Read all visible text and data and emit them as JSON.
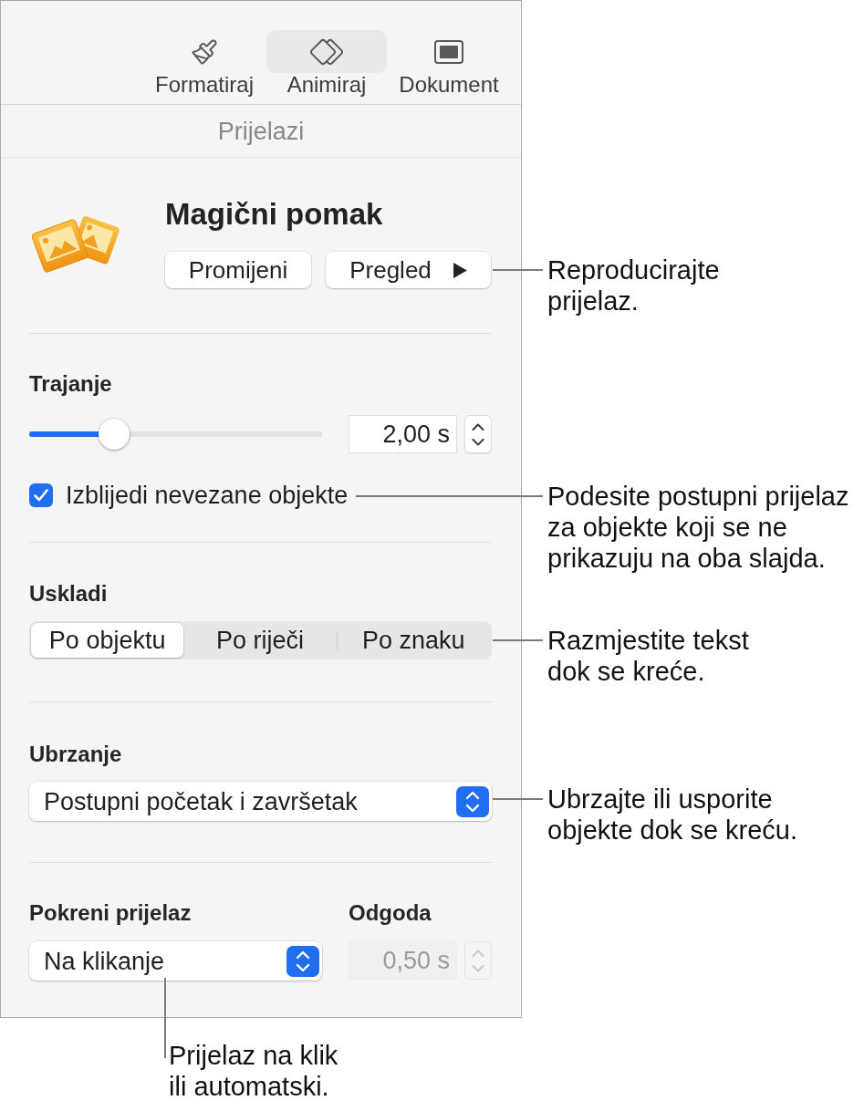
{
  "toolbar": {
    "tabs": [
      {
        "label": "Formatiraj",
        "kind": "format",
        "selected": false
      },
      {
        "label": "Animiraj",
        "kind": "animate",
        "selected": true
      },
      {
        "label": "Dokument",
        "kind": "document",
        "selected": false
      }
    ]
  },
  "panel_title": "Prijelazi",
  "effect": {
    "title": "Magični pomak",
    "buttons": [
      {
        "label": "Promijeni",
        "kind": "plain"
      },
      {
        "label": "Pregled",
        "kind": "play"
      }
    ]
  },
  "duration": {
    "label": "Trajanje",
    "level": 0.29,
    "value": "2,00 s"
  },
  "fade_checkbox": {
    "label": "Izblijedi nevezane objekte",
    "checked": true
  },
  "align": {
    "label": "Uskladi",
    "segments": [
      {
        "label": "Po objektu",
        "selected": true
      },
      {
        "label": "Po riječi",
        "selected": false
      },
      {
        "label": "Po znaku",
        "selected": false
      }
    ]
  },
  "acceleration": {
    "label": "Ubrzanje",
    "value": "Postupni početak i završetak"
  },
  "start": {
    "label": "Pokreni prijelaz",
    "value": "Na klikanje"
  },
  "delay": {
    "label": "Odgoda",
    "value": "0,50 s",
    "disabled": true
  },
  "callouts": [
    {
      "kind": "side",
      "text": "Reproducirajte\nprijelaz."
    },
    {
      "kind": "side",
      "text": "Podesite postupni prijelaz\nza objekte koji se ne\nprikazuju na oba slajda."
    },
    {
      "kind": "side",
      "text": "Razmjestite tekst\ndok se kreće."
    },
    {
      "kind": "side",
      "text": "Ubrzajte ili usporite\nobjekte dok se kreću."
    },
    {
      "kind": "below",
      "text": "Prijelaz na klik\nili automatski."
    }
  ]
}
